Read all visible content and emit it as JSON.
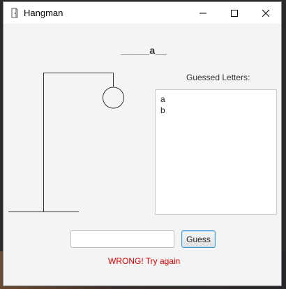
{
  "window": {
    "title": "Hangman"
  },
  "game": {
    "word_display": "_____a__",
    "guessed_label": "Guessed Letters:",
    "guessed_letters": [
      "a",
      "b"
    ],
    "guess_input_value": "",
    "guess_button_label": "Guess",
    "status_message": "WRONG! Try again",
    "status_color": "#e00000"
  },
  "icons": {
    "app": "app-icon",
    "minimize": "minimize-icon",
    "maximize": "maximize-icon",
    "close": "close-icon"
  },
  "colors": {
    "window_bg": "#f4f4f4",
    "titlebar_bg": "#ffffff",
    "button_focus": "#3f9ad6"
  }
}
